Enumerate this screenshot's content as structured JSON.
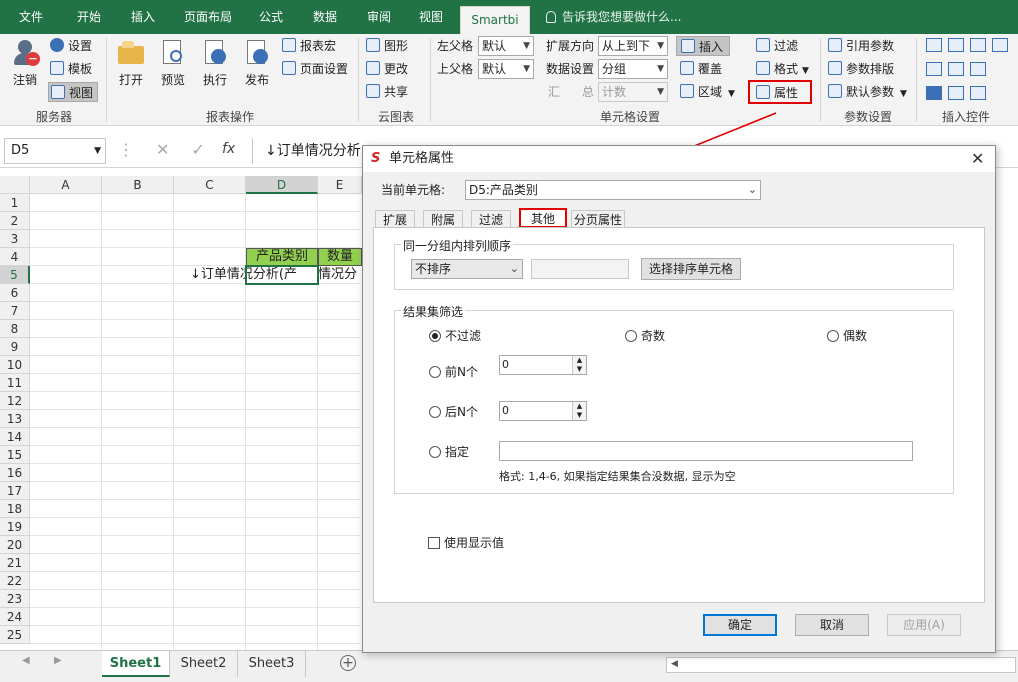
{
  "ribbon_tabs": [
    "文件",
    "开始",
    "插入",
    "页面布局",
    "公式",
    "数据",
    "审阅",
    "视图",
    "Smartbi"
  ],
  "tell_me": "告诉我您想要做什么...",
  "ribbon": {
    "server": {
      "logout": "注销",
      "settings": "设置",
      "template": "模板",
      "view": "视图",
      "label": "服务器"
    },
    "report_ops": {
      "open": "打开",
      "preview": "预览",
      "execute": "执行",
      "publish": "发布",
      "macro": "报表宏",
      "page_setup": "页面设置",
      "label": "报表操作"
    },
    "cloud_chart": {
      "chart": "图形",
      "change": "更改",
      "share": "共享",
      "label": "云图表"
    },
    "cell_settings": {
      "left_parent": "左父格",
      "left_parent_val": "默认",
      "top_parent": "上父格",
      "top_parent_val": "默认",
      "expand_dir": "扩展方向",
      "expand_dir_val": "从上到下",
      "data_setting": "数据设置",
      "data_setting_val": "分组",
      "summary1": "汇",
      "summary2": "总",
      "summary_val": "计数",
      "insert": "插入",
      "overwrite": "覆盖",
      "region": "区域",
      "filter": "过滤",
      "format": "格式",
      "properties": "属性",
      "label": "单元格设置"
    },
    "params": {
      "ref": "引用参数",
      "layout": "参数排版",
      "default": "默认参数",
      "label": "参数设置"
    },
    "controls": {
      "label": "插入控件"
    }
  },
  "formula": {
    "namebox": "D5",
    "content": "↓订单情况分析"
  },
  "sheet": {
    "columns": [
      "A",
      "B",
      "C",
      "D",
      "E"
    ],
    "rows": [
      "1",
      "2",
      "3",
      "4",
      "5",
      "6",
      "7",
      "8",
      "9",
      "10",
      "11",
      "12",
      "13",
      "14",
      "15",
      "16",
      "17",
      "18",
      "19",
      "20",
      "21",
      "22",
      "23",
      "24",
      "25"
    ],
    "d4": "产品类别",
    "e4": "数量",
    "c5": "↓订单情况分析(产",
    "e5": "情况分"
  },
  "sheet_tabs": [
    "Sheet1",
    "Sheet2",
    "Sheet3"
  ],
  "dialog": {
    "title": "单元格属性",
    "current_cell_label": "当前单元格:",
    "current_cell_val": "D5:产品类别",
    "tabs": [
      "扩展",
      "附属",
      "过滤",
      "其他",
      "分页属性"
    ],
    "sort_group": "同一分组内排列顺序",
    "sort_val": "不排序",
    "sort_btn": "选择排序单元格",
    "filter_group": "结果集筛选",
    "no_filter": "不过滤",
    "odd": "奇数",
    "even": "偶数",
    "first_n": "前N个",
    "first_n_val": "0",
    "last_n": "后N个",
    "last_n_val": "0",
    "specify": "指定",
    "format_hint": "格式: 1,4-6, 如果指定结果集合没数据, 显示为空",
    "use_display": "使用显示值",
    "ok": "确定",
    "cancel": "取消",
    "apply": "应用(A)"
  },
  "colors": {
    "excel_green": "#217346",
    "highlight": "#e00000",
    "header_green": "#92d050"
  }
}
